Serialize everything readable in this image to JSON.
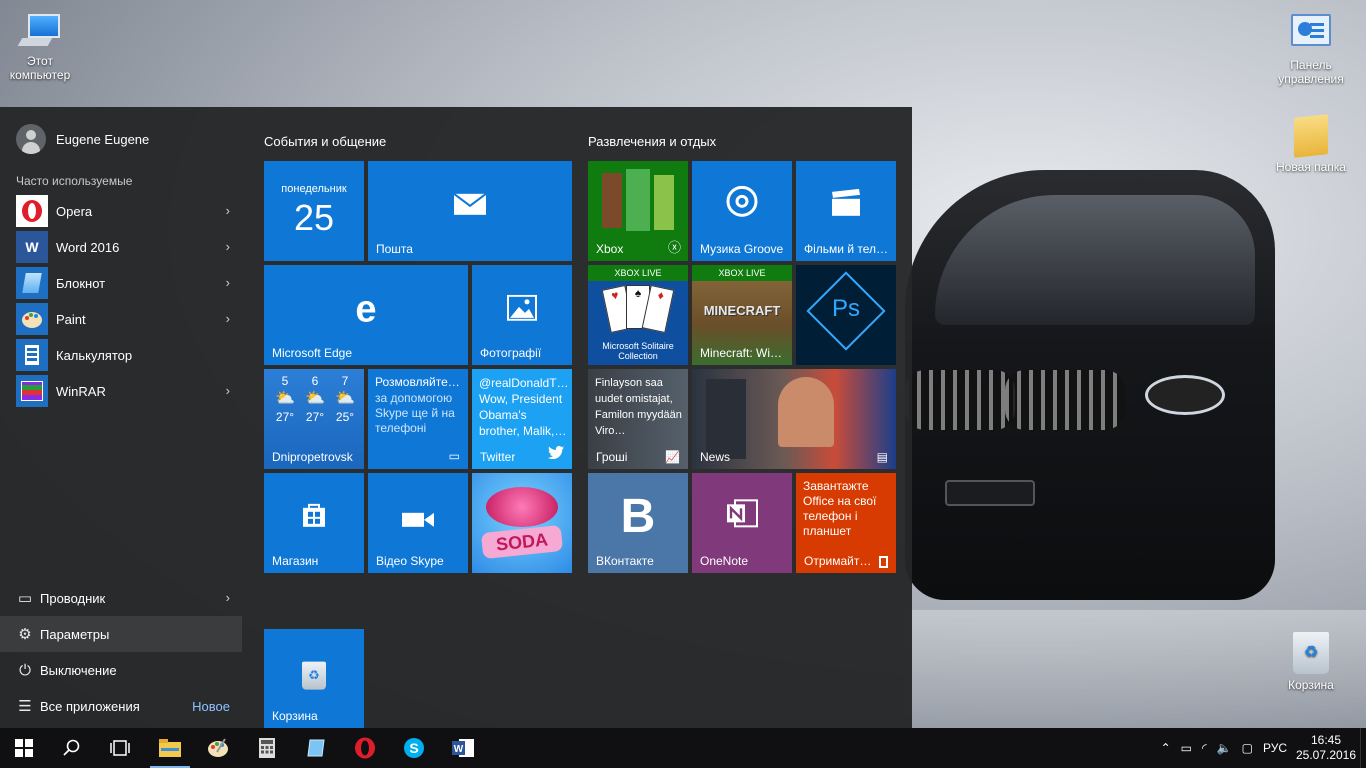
{
  "desktop": {
    "icons": [
      {
        "label": "Этот компьютер",
        "icon": "computer-icon"
      },
      {
        "label": "Панель управления",
        "icon": "control-panel-icon"
      },
      {
        "label": "Новая папка",
        "icon": "folder-icon"
      },
      {
        "label": "Корзина",
        "icon": "recycle-bin-icon"
      }
    ]
  },
  "start_menu": {
    "user_name": "Eugene Eugene",
    "frequent_label": "Часто используемые",
    "apps": [
      {
        "label": "Opera",
        "icon": "opera-icon",
        "has_submenu": true
      },
      {
        "label": "Word 2016",
        "icon": "word-icon",
        "has_submenu": true
      },
      {
        "label": "Блокнот",
        "icon": "notepad-icon",
        "has_submenu": true
      },
      {
        "label": "Paint",
        "icon": "paint-icon",
        "has_submenu": true
      },
      {
        "label": "Калькулятор",
        "icon": "calculator-icon",
        "has_submenu": false
      },
      {
        "label": "WinRAR",
        "icon": "winrar-icon",
        "has_submenu": true
      }
    ],
    "bottom": {
      "explorer": "Проводник",
      "settings": "Параметры",
      "power": "Выключение",
      "all_apps": "Все приложения",
      "new_badge": "Новое"
    },
    "groups": {
      "social_title": "События и общение",
      "entertainment_title": "Развлечения и отдых"
    },
    "tiles": {
      "calendar": {
        "day": "понедельник",
        "date": "25"
      },
      "mail": "Пошта",
      "edge": "Microsoft Edge",
      "photos": "Фотографії",
      "weather": {
        "city": "Dnipropetrovsk",
        "days": [
          {
            "day": "5",
            "temp": "27°"
          },
          {
            "day": "6",
            "temp": "27°"
          },
          {
            "day": "7",
            "temp": "25°"
          }
        ]
      },
      "skype_promo": {
        "title": "Розмовляйте…",
        "body": "за допомогою Skype ще й на телефоні"
      },
      "twitter": {
        "text": "@realDonaldT… Wow, President Obama's brother, Malik,…",
        "label": "Twitter"
      },
      "store": "Магазин",
      "skype_video": "Відео Skype",
      "candy": "SODA",
      "xbox": "Xbox",
      "groove": "Музика Groove",
      "films": "Фільми й тел…",
      "xbox_live_badge": "XBOX LIVE",
      "solitaire": "Microsoft Solitaire Collection",
      "minecraft": "Minecraft: Wi…",
      "minecraft_logo": "MINECRAFT",
      "photoshop": "Ps",
      "money": {
        "text": "Finlayson saa uudet omistajat, Familon myydään Viro…",
        "label": "Гроші"
      },
      "news": "News",
      "vk": "ВКонтакте",
      "onenote": "OneNote",
      "office_promo": {
        "text": "Завантажте Office на свої телефон і планшет",
        "label": "Отримайт…"
      },
      "recycle": "Корзина"
    }
  },
  "taskbar": {
    "lang": "РУС",
    "time": "16:45",
    "date": "25.07.2016"
  },
  "colors": {
    "tile_blue": "#0f78d7",
    "xbox_green": "#107c10",
    "onenote_purple": "#80397b",
    "office_orange": "#d83b01",
    "vk_blue": "#4a76a8",
    "ps_dark": "#001e36"
  }
}
